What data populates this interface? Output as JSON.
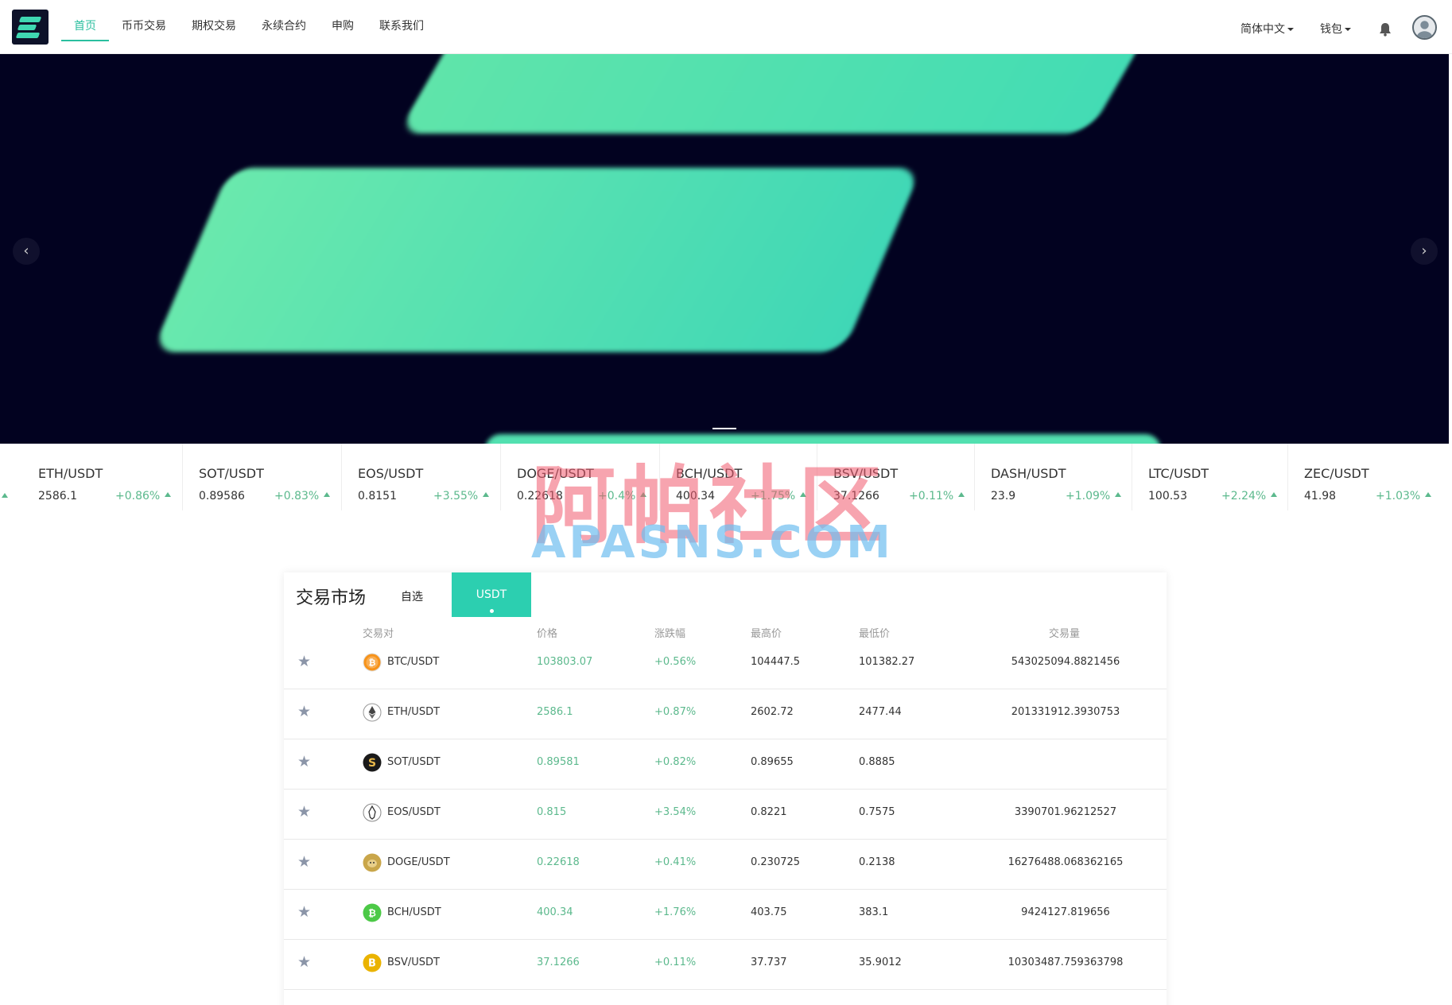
{
  "header": {
    "nav": [
      "首页",
      "币币交易",
      "期权交易",
      "永续合约",
      "申购",
      "联系我们"
    ],
    "language": "简体中文",
    "wallet": "钱包"
  },
  "banner": {
    "prev_symbol": "‹",
    "next_symbol": "›"
  },
  "ticker": [
    {
      "pair": "ETH/USDT",
      "price": "2586.1",
      "change": "+0.86%"
    },
    {
      "pair": "SOT/USDT",
      "price": "0.89586",
      "change": "+0.83%"
    },
    {
      "pair": "EOS/USDT",
      "price": "0.8151",
      "change": "+3.55%"
    },
    {
      "pair": "DOGE/USDT",
      "price": "0.22618",
      "change": "+0.4%"
    },
    {
      "pair": "BCH/USDT",
      "price": "400.34",
      "change": "+1.75%"
    },
    {
      "pair": "BSV/USDT",
      "price": "37.1266",
      "change": "+0.11%"
    },
    {
      "pair": "DASH/USDT",
      "price": "23.9",
      "change": "+1.09%"
    },
    {
      "pair": "LTC/USDT",
      "price": "100.53",
      "change": "+2.24%"
    },
    {
      "pair": "ZEC/USDT",
      "price": "41.98",
      "change": "+1.03%"
    }
  ],
  "watermark": {
    "cn": "阿帕社区",
    "en": "APASNS.COM"
  },
  "market": {
    "title": "交易市场",
    "tab_fav": "自选",
    "tab_usdt": "USDT",
    "columns": [
      "交易对",
      "价格",
      "涨跌幅",
      "最高价",
      "最低价",
      "交易量"
    ],
    "rows": [
      {
        "pair": "BTC/USDT",
        "price": "103803.07",
        "change": "+0.56%",
        "high": "104447.5",
        "low": "101382.27",
        "volume": "543025094.8821456",
        "coin_color": "#f7931a",
        "icon": "btc-icon"
      },
      {
        "pair": "ETH/USDT",
        "price": "2586.1",
        "change": "+0.87%",
        "high": "2602.72",
        "low": "2477.44",
        "volume": "201331912.3930753",
        "coin_color": "#ffffff",
        "icon": "eth-icon"
      },
      {
        "pair": "SOT/USDT",
        "price": "0.89581",
        "change": "+0.82%",
        "high": "0.89655",
        "low": "0.8885",
        "volume": "",
        "coin_color": "#1a1a1a",
        "icon": "sot-icon"
      },
      {
        "pair": "EOS/USDT",
        "price": "0.815",
        "change": "+3.54%",
        "high": "0.8221",
        "low": "0.7575",
        "volume": "3390701.96212527",
        "coin_color": "#ffffff",
        "icon": "eos-icon"
      },
      {
        "pair": "DOGE/USDT",
        "price": "0.22618",
        "change": "+0.41%",
        "high": "0.230725",
        "low": "0.2138",
        "volume": "16276488.068362165",
        "coin_color": "#c9a64a",
        "icon": "doge-icon"
      },
      {
        "pair": "BCH/USDT",
        "price": "400.34",
        "change": "+1.76%",
        "high": "403.75",
        "low": "383.1",
        "volume": "9424127.819656",
        "coin_color": "#4cc947",
        "icon": "bch-icon"
      },
      {
        "pair": "BSV/USDT",
        "price": "37.1266",
        "change": "+0.11%",
        "high": "37.737",
        "low": "35.9012",
        "volume": "10303487.759363798",
        "coin_color": "#eab300",
        "icon": "bsv-icon"
      }
    ]
  }
}
